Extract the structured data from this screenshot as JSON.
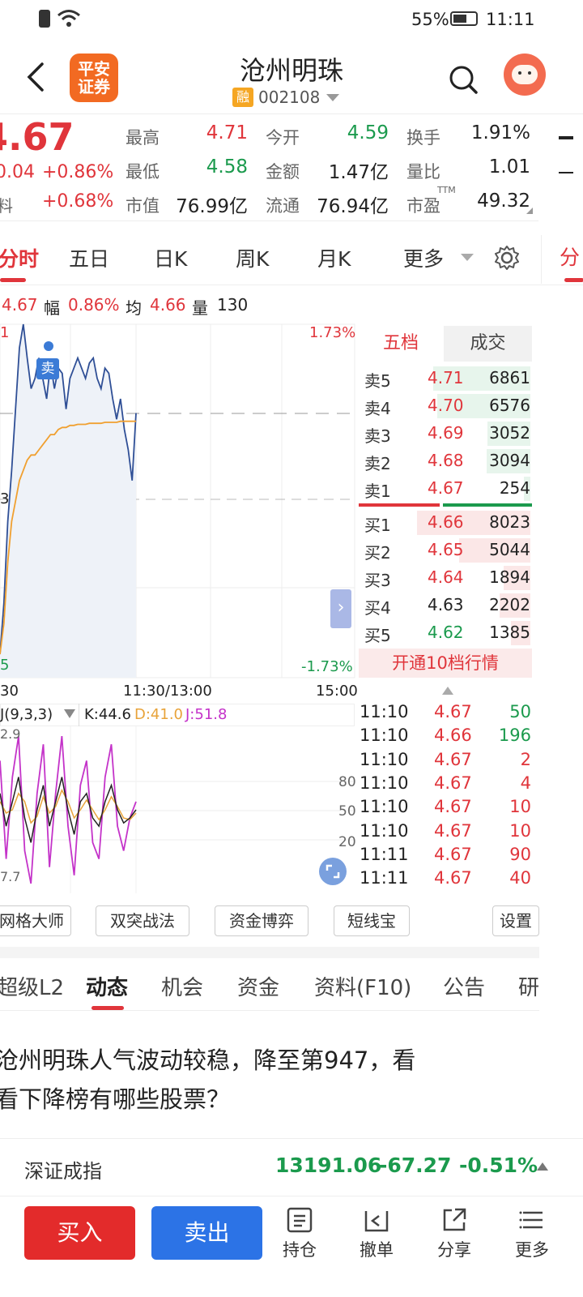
{
  "status": {
    "battery_pct": "55%",
    "time": "11:11"
  },
  "header": {
    "logo_line1": "平安",
    "logo_line2": "证券",
    "stock_name": "沧州明珠",
    "rong_badge": "融",
    "stock_code": "002108"
  },
  "quote": {
    "price": "4.67",
    "change": "0.04",
    "change_pct": "+0.86%",
    "label_left3": "料",
    "left3_val": "+0.68%",
    "high_label": "最高",
    "high": "4.71",
    "low_label": "最低",
    "low": "4.58",
    "mcap_label": "市值",
    "mcap": "76.99亿",
    "open_label": "今开",
    "open": "4.59",
    "amount_label": "金额",
    "amount": "1.47亿",
    "float_label": "流通",
    "float": "76.94亿",
    "turnover_label": "换手",
    "turnover": "1.91%",
    "volratio_label": "量比",
    "volratio": "1.01",
    "pe_label": "市盈",
    "pe_sup": "TTM",
    "pe": "49.32"
  },
  "tabs": [
    "分时",
    "五日",
    "日K",
    "周K",
    "月K",
    "更多"
  ],
  "chart_info": {
    "price": "4.67",
    "fu_label": "幅",
    "fu": "0.86%",
    "jun_label": "均",
    "jun": "4.66",
    "liang_label": "量",
    "liang": "130"
  },
  "chart_data": {
    "type": "line",
    "title": "",
    "ylim_pct": [
      -1.73,
      1.73
    ],
    "top_pct_label": "1.73%",
    "bottom_pct_label": "-1.73%",
    "left_top_label": "1",
    "left_mid_label": "3",
    "left_bottom_label": "5",
    "x_ticks": [
      "30",
      "11:30/13:00",
      "15:00"
    ],
    "sell_marker": "卖",
    "series": [
      {
        "values": [
          -1.5,
          -1.0,
          -0.2,
          0.3,
          0.9,
          1.5,
          1.73,
          1.4,
          1.1,
          1.2,
          1.4,
          1.2,
          1.0,
          1.35,
          1.1,
          1.3,
          1.25,
          0.9,
          1.2,
          1.3,
          1.4,
          1.3,
          1.2,
          1.35,
          1.4,
          1.2,
          1.1,
          1.3,
          1.25,
          1.0,
          0.8,
          1.0,
          0.7,
          0.5,
          0.2,
          0.86
        ]
      },
      {
        "values": [
          -1.5,
          -1.2,
          -0.6,
          -0.2,
          0.0,
          0.2,
          0.3,
          0.4,
          0.45,
          0.45,
          0.5,
          0.55,
          0.6,
          0.65,
          0.65,
          0.7,
          0.72,
          0.72,
          0.74,
          0.74,
          0.75,
          0.75,
          0.75,
          0.76,
          0.76,
          0.76,
          0.76,
          0.77,
          0.77,
          0.77,
          0.77,
          0.78,
          0.78,
          0.78,
          0.78,
          0.78
        ]
      }
    ]
  },
  "kdj": {
    "label": "J(9,3,3)",
    "k": "K:44.6",
    "d": "D:41.0",
    "j": "J:51.8",
    "axis_top": "2.9",
    "axis_bottom": "7.7",
    "levels": [
      "80",
      "50",
      "20"
    ],
    "k_values": [
      60,
      40,
      55,
      70,
      45,
      30,
      50,
      65,
      40,
      55,
      70,
      50,
      35,
      55,
      60,
      45,
      40,
      55,
      65,
      50,
      42,
      45,
      50
    ],
    "d_values": [
      55,
      48,
      50,
      60,
      55,
      42,
      46,
      58,
      48,
      52,
      62,
      55,
      45,
      50,
      56,
      50,
      44,
      50,
      58,
      52,
      45,
      44,
      48
    ],
    "j_values": [
      80,
      20,
      70,
      95,
      25,
      5,
      60,
      90,
      15,
      60,
      95,
      40,
      10,
      65,
      80,
      30,
      20,
      70,
      90,
      40,
      25,
      45,
      55
    ]
  },
  "orderbook": {
    "tab1": "五档",
    "tab2": "成交",
    "sells": [
      {
        "label": "卖5",
        "price": "4.71",
        "vol": "6861"
      },
      {
        "label": "卖4",
        "price": "4.70",
        "vol": "6576"
      },
      {
        "label": "卖3",
        "price": "4.69",
        "vol": "3052"
      },
      {
        "label": "卖2",
        "price": "4.68",
        "vol": "3094"
      },
      {
        "label": "卖1",
        "price": "4.67",
        "vol": "254"
      }
    ],
    "buys": [
      {
        "label": "买1",
        "price": "4.66",
        "vol": "8023"
      },
      {
        "label": "买2",
        "price": "4.65",
        "vol": "5044"
      },
      {
        "label": "买3",
        "price": "4.64",
        "vol": "1894"
      },
      {
        "label": "买4",
        "price": "4.63",
        "vol": "2202"
      },
      {
        "label": "买5",
        "price": "4.62",
        "vol": "1385"
      }
    ],
    "open10": "开通10档行情"
  },
  "ticks": [
    {
      "time": "11:10",
      "price": "4.67",
      "vol": "50",
      "vol_color": "green"
    },
    {
      "time": "11:10",
      "price": "4.66",
      "vol": "196",
      "vol_color": "green"
    },
    {
      "time": "11:10",
      "price": "4.67",
      "vol": "2",
      "vol_color": "red"
    },
    {
      "time": "11:10",
      "price": "4.67",
      "vol": "4",
      "vol_color": "red"
    },
    {
      "time": "11:10",
      "price": "4.67",
      "vol": "10",
      "vol_color": "red"
    },
    {
      "time": "11:10",
      "price": "4.67",
      "vol": "10",
      "vol_color": "red"
    },
    {
      "time": "11:11",
      "price": "4.67",
      "vol": "90",
      "vol_color": "red"
    },
    {
      "time": "11:11",
      "price": "4.67",
      "vol": "40",
      "vol_color": "red"
    }
  ],
  "tools": [
    "网格大师",
    "双突战法",
    "资金博弈",
    "短线宝",
    "设置"
  ],
  "bottom_tabs": [
    "超级L2",
    "动态",
    "机会",
    "资金",
    "资料(F10)",
    "公告",
    "研"
  ],
  "news": {
    "line1": "沧州明珠人气波动较稳，降至第947，看",
    "line2": "看下降榜有哪些股票？"
  },
  "index": {
    "name": "深证成指",
    "value": "13191.06",
    "change": "-67.27",
    "pct": "-0.51%"
  },
  "actions": {
    "buy": "买入",
    "sell": "卖出",
    "hold": "持仓",
    "cancel": "撤单",
    "share": "分享",
    "more": "更多"
  },
  "colors": {
    "up": "#e0353b",
    "down": "#1b9a4d",
    "accent": "#2c73e6"
  }
}
